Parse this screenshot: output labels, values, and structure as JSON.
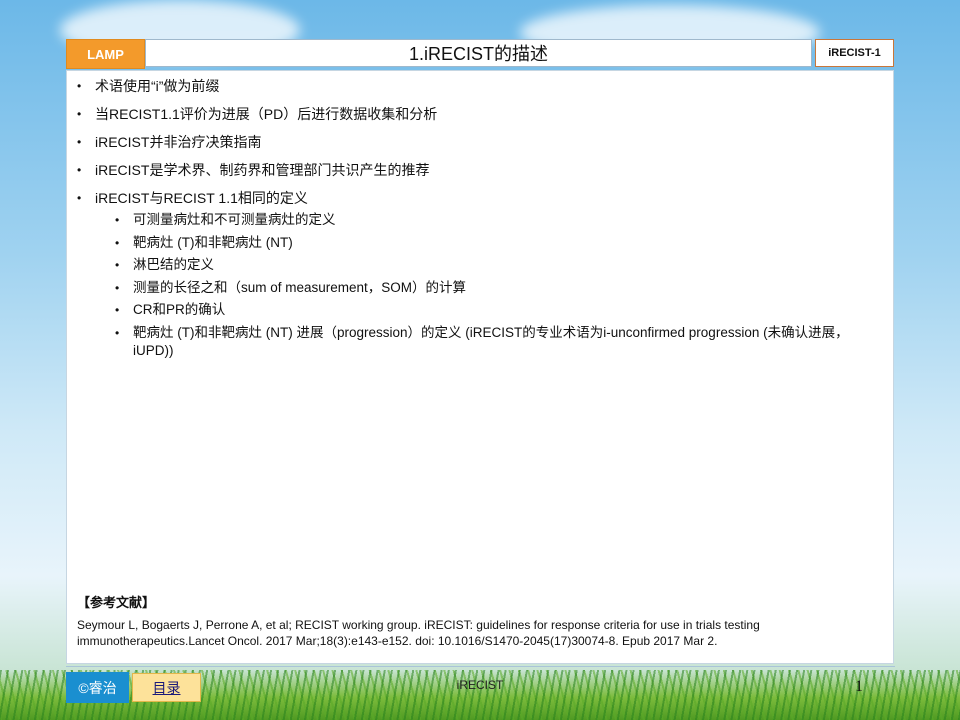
{
  "header": {
    "brand": "LAMP",
    "title": "1.iRECIST的描述",
    "tag": "iRECIST-1"
  },
  "bullets": [
    "术语使用“i”做为前缀",
    "当RECIST1.1评价为进展（PD）后进行数据收集和分析",
    "iRECIST并非治疗决策指南",
    "iRECIST是学术界、制药界和管理部门共识产生的推荐",
    "iRECIST与RECIST 1.1相同的定义"
  ],
  "sub_bullets": [
    "可测量病灶和不可测量病灶的定义",
    "靶病灶 (T)和非靶病灶 (NT)",
    "淋巴结的定义",
    "测量的长径之和（sum of measurement，SOM）的计算",
    "CR和PR的确认",
    "靶病灶 (T)和非靶病灶 (NT) 进展（progression）的定义 (iRECIST的专业术语为i-unconfirmed progression (未确认进展，iUPD))"
  ],
  "references": {
    "heading": "【参考文献】",
    "text": "Seymour L, Bogaerts J, Perrone A, et al; RECIST working group. iRECIST: guidelines for response criteria for use in trials testing immunotherapeutics.Lancet Oncol. 2017 Mar;18(3):e143-e152.  doi: 10.1016/S1470-2045(17)30074-8.  Epub 2017 Mar 2."
  },
  "footer": {
    "brand": "©睿治",
    "toc": "目录",
    "center": "iRECIST",
    "page": "1"
  }
}
